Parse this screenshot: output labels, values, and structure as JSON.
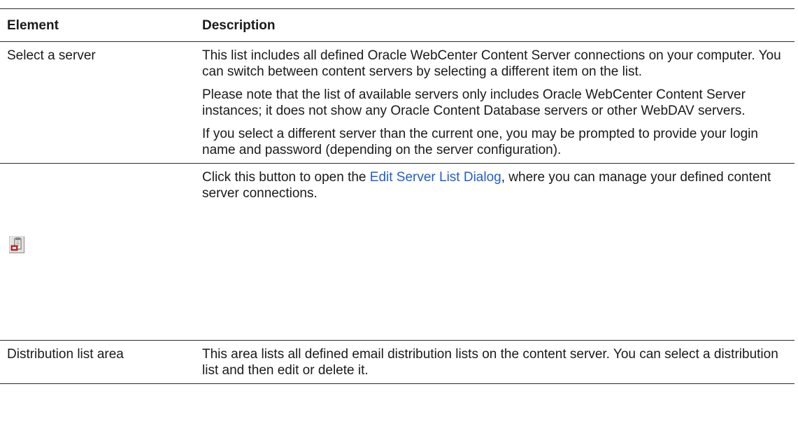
{
  "table": {
    "headers": {
      "element": "Element",
      "description": "Description"
    },
    "rows": [
      {
        "element": "Select a server",
        "paragraphs": [
          "This list includes all defined Oracle WebCenter Content Server connections on your computer. You can switch between content servers by selecting a different item on the list.",
          "Please note that the list of available servers only includes Oracle WebCenter Content Server instances; it does not show any Oracle Content Database servers or other WebDAV servers.",
          "If you select a different server than the current one, you may be prompted to provide your login name and password (depending on the server configuration)."
        ]
      },
      {
        "element_icon": "edit-server-list-icon",
        "text_before_link": "Click this button to open the ",
        "link_text": "Edit Server List Dialog",
        "text_after_link": ", where you can manage your defined content server connections."
      },
      {
        "element": "Distribution list area",
        "paragraphs": [
          "This area lists all defined email distribution lists on the content server. You can select a distribution list and then edit or delete it."
        ]
      }
    ]
  },
  "colors": {
    "link": "#1f5fce",
    "rule": "#2b2b2b",
    "text": "#1a1a1a",
    "icon_red": "#d9262c"
  }
}
